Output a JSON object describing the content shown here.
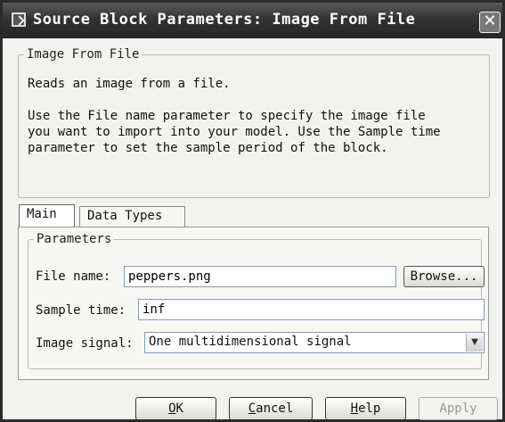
{
  "window": {
    "title": "Source Block Parameters: Image From File",
    "close_glyph": "✕"
  },
  "description": {
    "legend": "Image From File",
    "lines": [
      "Reads an image from a file.",
      "Use the File name parameter to specify the image file",
      "you want to import into your model. Use the Sample time",
      "parameter to set the sample period of the block."
    ]
  },
  "tabs": [
    {
      "label": "Main",
      "active": true
    },
    {
      "label": "Data Types",
      "active": false
    }
  ],
  "parameters": {
    "legend": "Parameters",
    "file_name": {
      "label": "File name:",
      "value": "peppers.png"
    },
    "browse_label": "Browse...",
    "sample_time": {
      "label": "Sample time:",
      "value": "inf"
    },
    "image_signal": {
      "label": "Image signal:",
      "value": "One multidimensional signal"
    }
  },
  "footer": {
    "ok": "OK",
    "cancel": "Cancel",
    "help": "Help",
    "apply": "Apply"
  },
  "icons": {
    "dropdown": "chevron-down-icon",
    "close": "close-icon",
    "app": "block-parameters-icon"
  }
}
